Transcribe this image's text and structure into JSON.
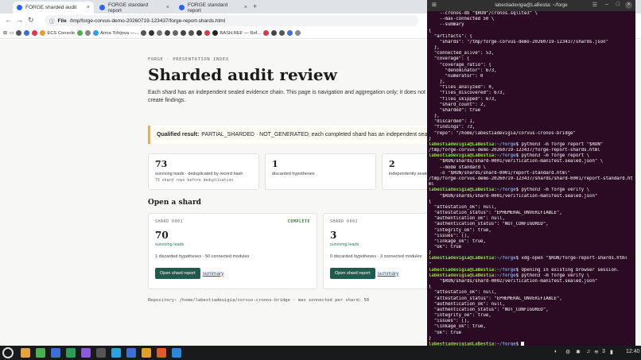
{
  "browser": {
    "tabs": [
      {
        "label": "FORGE sharded audit"
      },
      {
        "label": "FORGE standard report"
      },
      {
        "label": "FORGE standard report"
      }
    ],
    "new_tab": "+",
    "url_scheme": "File",
    "url": "/tmp/forge-corvus-demo-20260719-123437/forge-report-shards.html",
    "bookmarks": [
      "ECS Console",
      "Anna Tchijova —...",
      "BASH.REF — Ref..."
    ]
  },
  "page": {
    "eyebrow": "FORGE · PRESENTATION INDEX",
    "title": "Sharded audit review",
    "intro": "Each shard has an independent sealed evidence chain. This page is navigation and aggregation only; it does not create findings.",
    "banner_label": "Qualified result:",
    "banner_text": "PARTIAL_SHARDED · NOT_GENERATED; each completed shard has an independent seal",
    "metrics": [
      {
        "value": "73",
        "label": "surviving leads · deduplicated by record hash",
        "sub": "73 shard rows before deduplication"
      },
      {
        "value": "1",
        "label": "discarded hypotheses",
        "sub": ""
      },
      {
        "value": "2",
        "label": "independently seale",
        "sub": ""
      }
    ],
    "section_title": "Open a shard",
    "shards": [
      {
        "id": "SHARD 0001",
        "status": "COMPLETE",
        "value": "70",
        "label": "surviving leads",
        "desc": "1 discarded hypotheses · 50 connected modules",
        "button": "Open shard report",
        "link": "summary"
      },
      {
        "id": "SHARD 0002",
        "status": "",
        "value": "3",
        "label": "surviving leads",
        "desc": "0 discarded hypotheses · 3 connected modules",
        "button": "Open shard report",
        "link": "summary"
      }
    ],
    "footer": "Repository: /home/labestiadevigia/corvus-cronos-bridge · max connected per shard: 50"
  },
  "terminal": {
    "title": "labestiadevigia@LaBestia: ~/forge",
    "lines": [
      {
        "text": "    --cronos-db \"$RUN\"/cronos.sqlite3\" \\"
      },
      {
        "text": "    --max-connected 50 \\"
      },
      {
        "text": "    --summary"
      },
      {
        "text": "{"
      },
      {
        "text": "  \"artifacts\": {"
      },
      {
        "text": "    \"shards\": \"/tmp/forge-corvus-demo-20260719-123437/shards.json\""
      },
      {
        "text": "  },"
      },
      {
        "text": "  \"connected_alive\": 53,"
      },
      {
        "text": "  \"coverage\": {"
      },
      {
        "text": "    \"coverage_ratio\": {"
      },
      {
        "text": "      \"denominator\": 673,"
      },
      {
        "text": "      \"numerator\": 0"
      },
      {
        "text": "    },"
      },
      {
        "text": "    \"files_analyzed\": 0,"
      },
      {
        "text": "    \"files_discovered\": 673,"
      },
      {
        "text": "    \"files_skipped\": 673,"
      },
      {
        "text": "    \"shard_count\": 2,"
      },
      {
        "text": "    \"sharded\": true"
      },
      {
        "text": "  },"
      },
      {
        "text": "  \"discarded\": 1,"
      },
      {
        "text": "  \"findings\": 73,"
      },
      {
        "text": "  \"repo\": \"/home/labestiadevigia/corvus-cronos-bridge\""
      },
      {
        "text": "}"
      },
      {
        "user": "labestiadevigia@LaBestia",
        "path": "~/forge",
        "text": "$ python3 -m forge report \"$RUN\""
      },
      {
        "text": "/tmp/forge-corvus-demo-20260719-123437/forge-report-shards.html"
      },
      {
        "user": "labestiadevigia@LaBestia",
        "path": "~/forge",
        "text": "$ python3 -m forge report \\"
      },
      {
        "text": "    \"$RUN/shards/shard-0001/verification-manifest.sealed.json\" \\"
      },
      {
        "text": "    --mode standard \\"
      },
      {
        "text": "    -o \"$RUN/shards/shard-0001/report-standard.html\""
      },
      {
        "text": "/tmp/forge-corvus-demo-20260719-123437/shards/shard-0001/report-standard.ht"
      },
      {
        "text": "ml"
      },
      {
        "user": "labestiadevigia@LaBestia",
        "path": "~/forge",
        "text": "$ python3 -m forge verify \\"
      },
      {
        "text": "    \"$RUN/shards/shard-0001/verification-manifest.sealed.json\""
      },
      {
        "text": "{"
      },
      {
        "text": "  \"attestation_ok\": null,"
      },
      {
        "text": "  \"attestation_status\": \"EPHEMERAL_UNVERIFIABLE\","
      },
      {
        "text": "  \"authentication_ok\": null,"
      },
      {
        "text": "  \"authentication_status\": \"NOT_CONFIGURED\","
      },
      {
        "text": "  \"integrity_ok\": true,"
      },
      {
        "text": "  \"issues\": [],"
      },
      {
        "text": "  \"linkage_ok\": true,"
      },
      {
        "text": "  \"ok\": true"
      },
      {
        "text": "}"
      },
      {
        "user": "labestiadevigia@LaBestia",
        "path": "~/forge",
        "text": "$ xdg-open \"$RUN/forge-report-shards.html"
      },
      {
        "text": "\""
      },
      {
        "user": "labestiadevigia@LaBestia",
        "path": "~/forge",
        "text": "$ Opening in existing browser session."
      },
      {
        "user": "labestiadevigia@LaBestia",
        "path": "~/forge",
        "text": "$ python3 -m forge verify \\"
      },
      {
        "text": "    \"$RUN/shards/shard-0002/verification-manifest.sealed.json\""
      },
      {
        "text": "{"
      },
      {
        "text": "  \"attestation_ok\": null,"
      },
      {
        "text": "  \"attestation_status\": \"EPHEMERAL_UNVERIFIABLE\","
      },
      {
        "text": "  \"authentication_ok\": null,"
      },
      {
        "text": "  \"authentication_status\": \"NOT_CONFIGURED\","
      },
      {
        "text": "  \"integrity_ok\": true,"
      },
      {
        "text": "  \"issues\": [],"
      },
      {
        "text": "  \"linkage_ok\": true,"
      },
      {
        "text": "  \"ok\": true"
      },
      {
        "text": "}"
      },
      {
        "user": "labestiadevigia@LaBestia",
        "path": "~/forge",
        "text": "$ ",
        "cursor": true
      }
    ]
  },
  "taskbar": {
    "apps": [
      {
        "name": "files-icon",
        "color": "#e6a23c"
      },
      {
        "name": "chrome-icon",
        "color": "#4caf50"
      },
      {
        "name": "mail-icon",
        "color": "#3d6fd8"
      },
      {
        "name": "spreadsheet-icon",
        "color": "#2e9d5a"
      },
      {
        "name": "notes-icon",
        "color": "#8e5bd8"
      },
      {
        "name": "terminal-icon",
        "color": "#555555"
      },
      {
        "name": "telegram-icon",
        "color": "#2aa3e0"
      },
      {
        "name": "docs-icon",
        "color": "#3d6fd8"
      },
      {
        "name": "presentation-icon",
        "color": "#e0a030"
      },
      {
        "name": "app-icon",
        "color": "#e05a2a"
      },
      {
        "name": "vscode-icon",
        "color": "#2b88d8"
      }
    ],
    "tray_count": "3",
    "clock": "12:40"
  }
}
